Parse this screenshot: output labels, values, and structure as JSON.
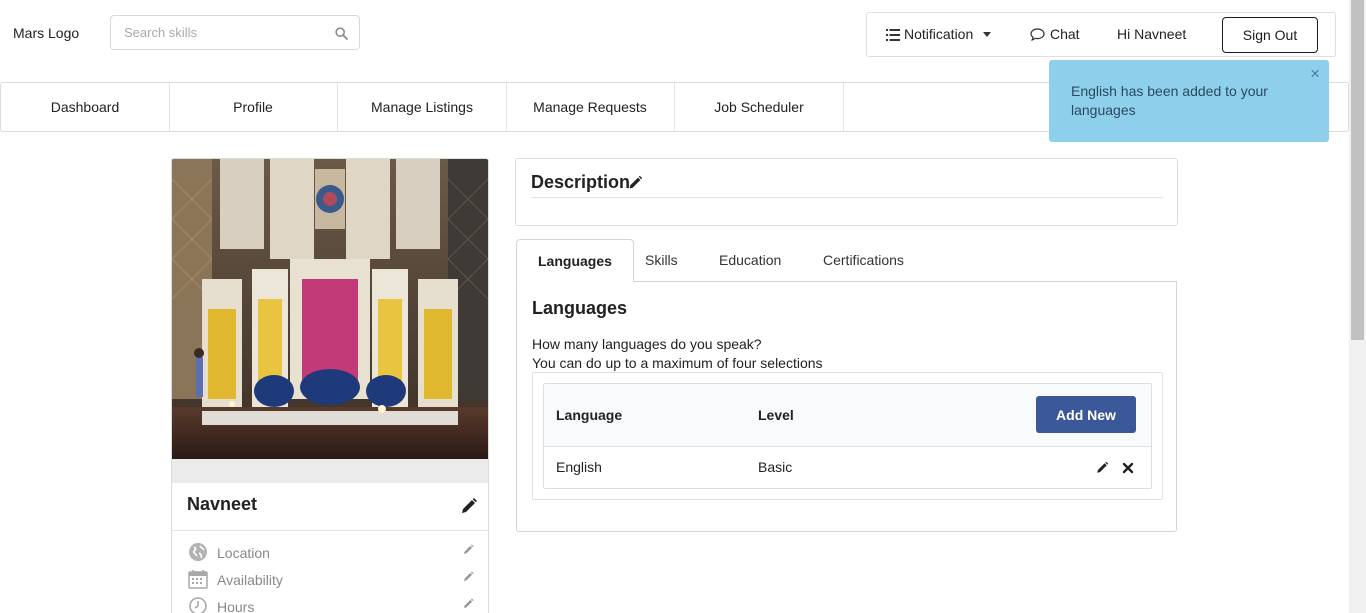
{
  "header": {
    "logo_text": "Mars Logo",
    "search_placeholder": "Search skills",
    "notification_label": "Notification",
    "chat_label": "Chat",
    "greeting": "Hi Navneet",
    "signout_label": "Sign Out"
  },
  "nav": {
    "items": [
      "Dashboard",
      "Profile",
      "Manage Listings",
      "Manage Requests",
      "Job Scheduler"
    ]
  },
  "toast": {
    "message": "English has been added to your languages",
    "close_glyph": "×",
    "color": "#8ed0ec"
  },
  "profile": {
    "name": "Navneet",
    "details": [
      {
        "label": "Location",
        "icon": "globe-icon"
      },
      {
        "label": "Availability",
        "icon": "calendar-icon"
      },
      {
        "label": "Hours",
        "icon": "clock-icon"
      }
    ]
  },
  "description": {
    "title": "Description"
  },
  "tabs": [
    {
      "label": "Languages",
      "active": true
    },
    {
      "label": "Skills",
      "active": false
    },
    {
      "label": "Education",
      "active": false
    },
    {
      "label": "Certifications",
      "active": false
    }
  ],
  "languages": {
    "title": "Languages",
    "question": "How many languages do you speak?",
    "hint": "You can do up to a maximum of four selections",
    "columns": [
      "Language",
      "Level"
    ],
    "add_button": "Add New",
    "rows": [
      {
        "language": "English",
        "level": "Basic"
      }
    ]
  },
  "colors": {
    "accent_button": "#3b5998",
    "toast_bg": "#8ed0ec"
  }
}
